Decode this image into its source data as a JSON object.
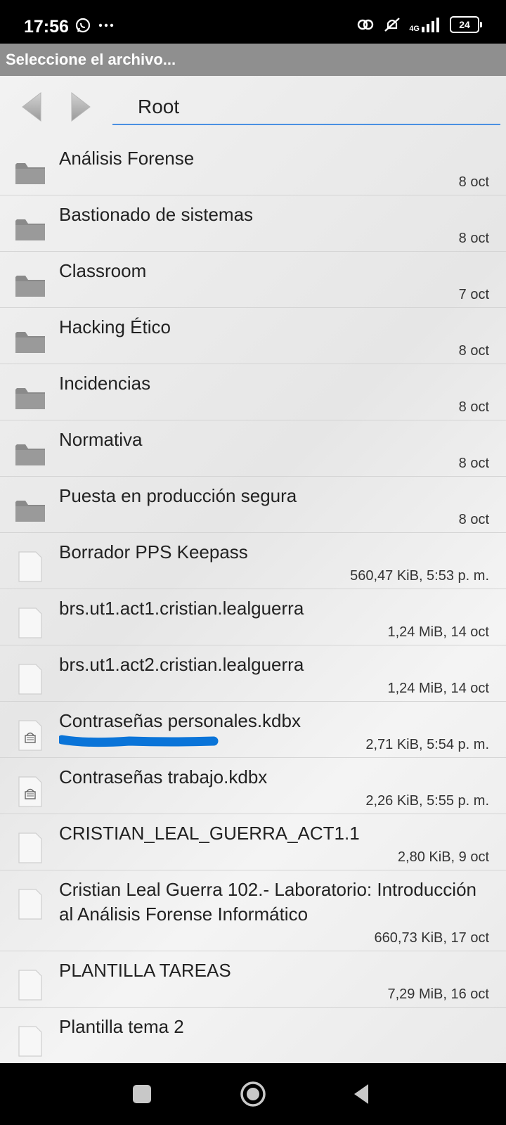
{
  "status": {
    "time": "17:56",
    "network": "4G",
    "battery": "24",
    "icons": [
      "whatsapp-icon",
      "more-icon",
      "link-icon",
      "mute-icon",
      "signal-icon",
      "battery-icon"
    ]
  },
  "dialog": {
    "title": "Seleccione el archivo..."
  },
  "toolbar": {
    "path": "Root"
  },
  "files": [
    {
      "name": "Análisis Forense",
      "meta": "8 oct",
      "type": "folder"
    },
    {
      "name": "Bastionado de sistemas",
      "meta": "8 oct",
      "type": "folder"
    },
    {
      "name": "Classroom",
      "meta": "7 oct",
      "type": "folder"
    },
    {
      "name": "Hacking Ético",
      "meta": "8 oct",
      "type": "folder"
    },
    {
      "name": "Incidencias",
      "meta": "8 oct",
      "type": "folder"
    },
    {
      "name": "Normativa",
      "meta": "8 oct",
      "type": "folder"
    },
    {
      "name": "Puesta en producción segura",
      "meta": "8 oct",
      "type": "folder"
    },
    {
      "name": "Borrador PPS Keepass",
      "meta": "560,47 KiB, 5:53 p. m.",
      "type": "file"
    },
    {
      "name": "brs.ut1.act1.cristian.lealguerra",
      "meta": "1,24 MiB, 14 oct",
      "type": "file"
    },
    {
      "name": "brs.ut1.act2.cristian.lealguerra",
      "meta": "1,24 MiB, 14 oct",
      "type": "file"
    },
    {
      "name": "Contraseñas personales.kdbx",
      "meta": "2,71 KiB, 5:54 p. m.",
      "type": "database"
    },
    {
      "name": "Contraseñas trabajo.kdbx",
      "meta": "2,26 KiB, 5:55 p. m.",
      "type": "database"
    },
    {
      "name": "CRISTIAN_LEAL_GUERRA_ACT1.1",
      "meta": "2,80 KiB, 9 oct",
      "type": "file"
    },
    {
      "name": "Cristian Leal Guerra 102.- Laboratorio: Introducción al Análisis Forense Informático",
      "meta": "660,73 KiB, 17 oct",
      "type": "file"
    },
    {
      "name": "PLANTILLA TAREAS",
      "meta": "7,29 MiB, 16 oct",
      "type": "file"
    },
    {
      "name": "Plantilla tema 2",
      "meta": "",
      "type": "file"
    }
  ],
  "colors": {
    "accent_underline": "#4a90e2",
    "highlight_stroke": "#0a74d8",
    "title_bar": "#8f8f8f",
    "folder_icon": "#8a8a8a"
  }
}
